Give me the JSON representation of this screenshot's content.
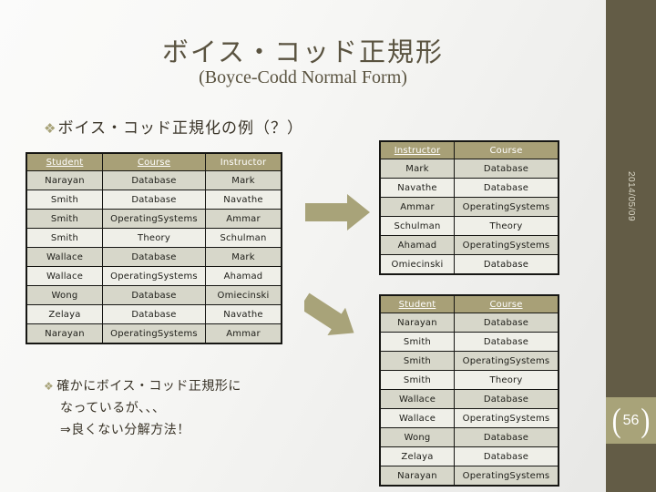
{
  "slide": {
    "title": "ボイス・コッド正規形",
    "subtitle": "(Boyce-Codd Normal Form)",
    "date": "2014/05/09",
    "page_number": "56",
    "bracket_left": "(",
    "bracket_right": ")"
  },
  "colors": {
    "sidebar": "#635c46",
    "accent": "#a8a379",
    "table_header": "#a8a077",
    "row_odd": "#d7d7ca",
    "row_even": "#efefe8",
    "title_text": "#5a5340",
    "arrow": "#a8a379"
  },
  "bullets": {
    "top": {
      "marker": "❖",
      "text": "ボイス・コッド正規化の例（？）"
    },
    "bottom": {
      "marker": "❖",
      "line1": "確かにボイス・コッド正規形に",
      "line2": "なっているが、、、",
      "line3": "⇒良くない分解方法！"
    }
  },
  "arrows": [
    {
      "name": "arrow-right",
      "direction": "right"
    },
    {
      "name": "arrow-diagonal",
      "direction": "down-right"
    }
  ],
  "tables": {
    "original": {
      "name": "student-course-instructor-table",
      "headers": [
        {
          "label": "Student",
          "key": true
        },
        {
          "label": "Course",
          "key": true
        },
        {
          "label": "Instructor",
          "key": false
        }
      ],
      "rows": [
        [
          "Narayan",
          "Database",
          "Mark"
        ],
        [
          "Smith",
          "Database",
          "Navathe"
        ],
        [
          "Smith",
          "OperatingSystems",
          "Ammar"
        ],
        [
          "Smith",
          "Theory",
          "Schulman"
        ],
        [
          "Wallace",
          "Database",
          "Mark"
        ],
        [
          "Wallace",
          "OperatingSystems",
          "Ahamad"
        ],
        [
          "Wong",
          "Database",
          "Omiecinski"
        ],
        [
          "Zelaya",
          "Database",
          "Navathe"
        ],
        [
          "Narayan",
          "OperatingSystems",
          "Ammar"
        ]
      ]
    },
    "instructor_course": {
      "name": "instructor-course-table",
      "headers": [
        {
          "label": "Instructor",
          "key": true
        },
        {
          "label": "Course",
          "key": false
        }
      ],
      "rows": [
        [
          "Mark",
          "Database"
        ],
        [
          "Navathe",
          "Database"
        ],
        [
          "Ammar",
          "OperatingSystems"
        ],
        [
          "Schulman",
          "Theory"
        ],
        [
          "Ahamad",
          "OperatingSystems"
        ],
        [
          "Omiecinski",
          "Database"
        ]
      ]
    },
    "student_course": {
      "name": "student-course-table",
      "headers": [
        {
          "label": "Student",
          "key": true
        },
        {
          "label": "Course",
          "key": true
        }
      ],
      "rows": [
        [
          "Narayan",
          "Database"
        ],
        [
          "Smith",
          "Database"
        ],
        [
          "Smith",
          "OperatingSystems"
        ],
        [
          "Smith",
          "Theory"
        ],
        [
          "Wallace",
          "Database"
        ],
        [
          "Wallace",
          "OperatingSystems"
        ],
        [
          "Wong",
          "Database"
        ],
        [
          "Zelaya",
          "Database"
        ],
        [
          "Narayan",
          "OperatingSystems"
        ]
      ]
    }
  }
}
